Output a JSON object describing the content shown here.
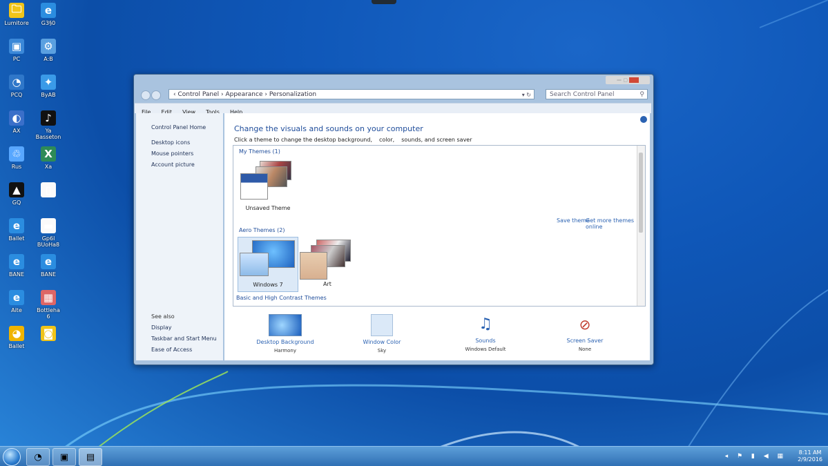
{
  "desktop_icons": [
    {
      "label": "Lumitore",
      "glyph": "🗀",
      "color": "#f0c419"
    },
    {
      "label": "G3§0",
      "glyph": "e",
      "color": "#2b8de0"
    },
    {
      "label": "PC",
      "glyph": "▣",
      "color": "#3b88d8"
    },
    {
      "label": "A:B",
      "glyph": "⚙",
      "color": "#5aa0e0"
    },
    {
      "label": "PCQ",
      "glyph": "◔",
      "color": "#2f77c9"
    },
    {
      "label": "ByAB",
      "glyph": "✦",
      "color": "#3a9ae8"
    },
    {
      "label": "AX",
      "glyph": "◐",
      "color": "#3a6fc9"
    },
    {
      "label": "Ya\nBasseton",
      "glyph": "♪",
      "color": "#111"
    },
    {
      "label": "Rus",
      "glyph": "♲",
      "color": "#58a7ff"
    },
    {
      "label": "Xa",
      "glyph": "X",
      "color": "#2e8b57"
    },
    {
      "label": "GQ",
      "glyph": "▲",
      "color": "#111"
    },
    {
      "label": "",
      "glyph": "▯",
      "color": "#fafafa"
    },
    {
      "label": "Ballet",
      "glyph": "e",
      "color": "#2b8de0"
    },
    {
      "label": "Gp6l\nBUoHa8",
      "glyph": "▬",
      "color": "#fafafa"
    },
    {
      "label": "BANE",
      "glyph": "e",
      "color": "#2b8de0"
    },
    {
      "label": "BANE",
      "glyph": "e",
      "color": "#2b8de0"
    },
    {
      "label": "Aite",
      "glyph": "e",
      "color": "#2b8de0"
    },
    {
      "label": "Bottleha\n6",
      "glyph": "▦",
      "color": "#d66"
    },
    {
      "label": "Ballet",
      "glyph": "◕",
      "color": "#f0b400"
    },
    {
      "label": "",
      "glyph": "◙",
      "color": "#f0c419"
    }
  ],
  "window": {
    "titlebar_controls": "— ▢",
    "address": "‹ Control Panel › Appearance › Personalization",
    "address_ctrl": "▾ ↻",
    "search_placeholder": "Search Control Panel",
    "menu": [
      "File",
      "Edit",
      "View",
      "Tools",
      "Help"
    ],
    "nav_top": [
      "Control Panel Home"
    ],
    "nav_links": [
      "Desktop icons",
      "Mouse pointers",
      "Account picture"
    ],
    "nav_see_also": [
      "See also",
      "Display",
      "Taskbar and Start Menu",
      "Ease of Access"
    ],
    "heading": "Change the visuals and sounds on your computer",
    "subline": [
      "Click a theme to change the desktop background,",
      "color,",
      "sounds, and screen saver"
    ],
    "section_my_themes": "My Themes (1)",
    "my_theme_name": "Unsaved Theme",
    "links": [
      "Save theme",
      "Get more themes online"
    ],
    "section_aero": "Aero Themes (2)",
    "aero_themes": [
      "Windows 7",
      "Art"
    ],
    "section_basic": "Basic and High Contrast Themes",
    "bottom_items": [
      {
        "title": "Desktop Background",
        "sub": "Harmony"
      },
      {
        "title": "Window Color",
        "sub": "Sky"
      },
      {
        "title": "Sounds",
        "sub": "Windows Default"
      },
      {
        "title": "Screen Saver",
        "sub": "None"
      }
    ]
  },
  "taskbar": {
    "buttons": [
      "◔",
      "▣",
      "▤"
    ],
    "tray": "◂ ⚑ ▮ ◀ ▦",
    "time": "8:11 AM",
    "date": "2/9/2016"
  }
}
